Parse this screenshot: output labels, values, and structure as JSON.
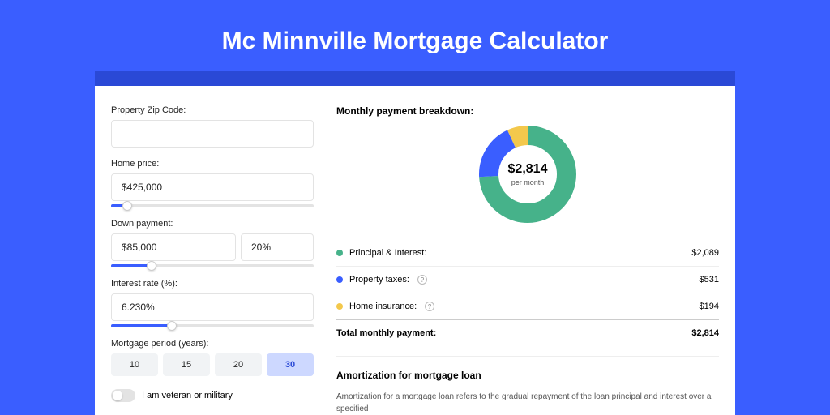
{
  "title": "Mc Minnville Mortgage Calculator",
  "form": {
    "zip": {
      "label": "Property Zip Code:",
      "value": ""
    },
    "home_price": {
      "label": "Home price:",
      "value": "$425,000",
      "slider_pct": 8
    },
    "down_payment": {
      "label": "Down payment:",
      "amount": "$85,000",
      "pct": "20%",
      "slider_pct": 20
    },
    "interest": {
      "label": "Interest rate (%):",
      "value": "6.230%",
      "slider_pct": 30
    },
    "period": {
      "label": "Mortgage period (years):",
      "options": [
        "10",
        "15",
        "20",
        "30"
      ],
      "active_index": 3
    },
    "veteran": {
      "label": "I am veteran or military",
      "on": false
    }
  },
  "breakdown": {
    "title": "Monthly payment breakdown:",
    "total_amount": "$2,814",
    "total_sub": "per month",
    "rows": [
      {
        "label": "Principal & Interest:",
        "value": "$2,089",
        "color": "#46b28a",
        "help": false,
        "pct": 74
      },
      {
        "label": "Property taxes:",
        "value": "$531",
        "color": "#3a5eff",
        "help": true,
        "pct": 19
      },
      {
        "label": "Home insurance:",
        "value": "$194",
        "color": "#f3c84c",
        "help": true,
        "pct": 7
      }
    ],
    "total_label": "Total monthly payment:",
    "total_value": "$2,814"
  },
  "amort": {
    "title": "Amortization for mortgage loan",
    "text": "Amortization for a mortgage loan refers to the gradual repayment of the loan principal and interest over a specified"
  },
  "chart_data": {
    "type": "pie",
    "title": "Monthly payment breakdown",
    "categories": [
      "Principal & Interest",
      "Property taxes",
      "Home insurance"
    ],
    "values": [
      2089,
      531,
      194
    ],
    "colors": [
      "#46b28a",
      "#3a5eff",
      "#f3c84c"
    ],
    "total": 2814,
    "center_label": "$2,814 per month"
  }
}
